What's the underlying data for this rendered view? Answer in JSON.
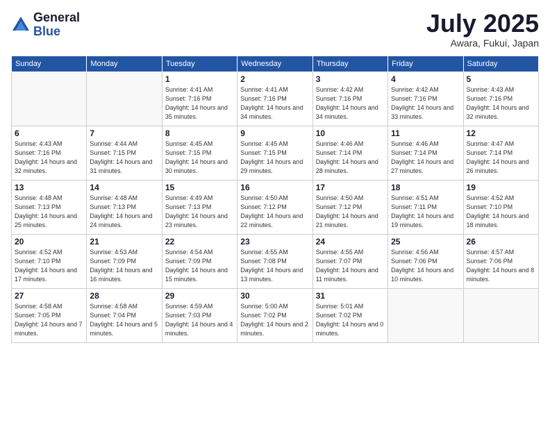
{
  "logo": {
    "general": "General",
    "blue": "Blue"
  },
  "header": {
    "month": "July 2025",
    "location": "Awara, Fukui, Japan"
  },
  "weekdays": [
    "Sunday",
    "Monday",
    "Tuesday",
    "Wednesday",
    "Thursday",
    "Friday",
    "Saturday"
  ],
  "weeks": [
    [
      {
        "day": "",
        "info": ""
      },
      {
        "day": "",
        "info": ""
      },
      {
        "day": "1",
        "sunrise": "Sunrise: 4:41 AM",
        "sunset": "Sunset: 7:16 PM",
        "daylight": "Daylight: 14 hours and 35 minutes."
      },
      {
        "day": "2",
        "sunrise": "Sunrise: 4:41 AM",
        "sunset": "Sunset: 7:16 PM",
        "daylight": "Daylight: 14 hours and 34 minutes."
      },
      {
        "day": "3",
        "sunrise": "Sunrise: 4:42 AM",
        "sunset": "Sunset: 7:16 PM",
        "daylight": "Daylight: 14 hours and 34 minutes."
      },
      {
        "day": "4",
        "sunrise": "Sunrise: 4:42 AM",
        "sunset": "Sunset: 7:16 PM",
        "daylight": "Daylight: 14 hours and 33 minutes."
      },
      {
        "day": "5",
        "sunrise": "Sunrise: 4:43 AM",
        "sunset": "Sunset: 7:16 PM",
        "daylight": "Daylight: 14 hours and 32 minutes."
      }
    ],
    [
      {
        "day": "6",
        "sunrise": "Sunrise: 4:43 AM",
        "sunset": "Sunset: 7:16 PM",
        "daylight": "Daylight: 14 hours and 32 minutes."
      },
      {
        "day": "7",
        "sunrise": "Sunrise: 4:44 AM",
        "sunset": "Sunset: 7:15 PM",
        "daylight": "Daylight: 14 hours and 31 minutes."
      },
      {
        "day": "8",
        "sunrise": "Sunrise: 4:45 AM",
        "sunset": "Sunset: 7:15 PM",
        "daylight": "Daylight: 14 hours and 30 minutes."
      },
      {
        "day": "9",
        "sunrise": "Sunrise: 4:45 AM",
        "sunset": "Sunset: 7:15 PM",
        "daylight": "Daylight: 14 hours and 29 minutes."
      },
      {
        "day": "10",
        "sunrise": "Sunrise: 4:46 AM",
        "sunset": "Sunset: 7:14 PM",
        "daylight": "Daylight: 14 hours and 28 minutes."
      },
      {
        "day": "11",
        "sunrise": "Sunrise: 4:46 AM",
        "sunset": "Sunset: 7:14 PM",
        "daylight": "Daylight: 14 hours and 27 minutes."
      },
      {
        "day": "12",
        "sunrise": "Sunrise: 4:47 AM",
        "sunset": "Sunset: 7:14 PM",
        "daylight": "Daylight: 14 hours and 26 minutes."
      }
    ],
    [
      {
        "day": "13",
        "sunrise": "Sunrise: 4:48 AM",
        "sunset": "Sunset: 7:13 PM",
        "daylight": "Daylight: 14 hours and 25 minutes."
      },
      {
        "day": "14",
        "sunrise": "Sunrise: 4:48 AM",
        "sunset": "Sunset: 7:13 PM",
        "daylight": "Daylight: 14 hours and 24 minutes."
      },
      {
        "day": "15",
        "sunrise": "Sunrise: 4:49 AM",
        "sunset": "Sunset: 7:13 PM",
        "daylight": "Daylight: 14 hours and 23 minutes."
      },
      {
        "day": "16",
        "sunrise": "Sunrise: 4:50 AM",
        "sunset": "Sunset: 7:12 PM",
        "daylight": "Daylight: 14 hours and 22 minutes."
      },
      {
        "day": "17",
        "sunrise": "Sunrise: 4:50 AM",
        "sunset": "Sunset: 7:12 PM",
        "daylight": "Daylight: 14 hours and 21 minutes."
      },
      {
        "day": "18",
        "sunrise": "Sunrise: 4:51 AM",
        "sunset": "Sunset: 7:11 PM",
        "daylight": "Daylight: 14 hours and 19 minutes."
      },
      {
        "day": "19",
        "sunrise": "Sunrise: 4:52 AM",
        "sunset": "Sunset: 7:10 PM",
        "daylight": "Daylight: 14 hours and 18 minutes."
      }
    ],
    [
      {
        "day": "20",
        "sunrise": "Sunrise: 4:52 AM",
        "sunset": "Sunset: 7:10 PM",
        "daylight": "Daylight: 14 hours and 17 minutes."
      },
      {
        "day": "21",
        "sunrise": "Sunrise: 4:53 AM",
        "sunset": "Sunset: 7:09 PM",
        "daylight": "Daylight: 14 hours and 16 minutes."
      },
      {
        "day": "22",
        "sunrise": "Sunrise: 4:54 AM",
        "sunset": "Sunset: 7:09 PM",
        "daylight": "Daylight: 14 hours and 15 minutes."
      },
      {
        "day": "23",
        "sunrise": "Sunrise: 4:55 AM",
        "sunset": "Sunset: 7:08 PM",
        "daylight": "Daylight: 14 hours and 13 minutes."
      },
      {
        "day": "24",
        "sunrise": "Sunrise: 4:55 AM",
        "sunset": "Sunset: 7:07 PM",
        "daylight": "Daylight: 14 hours and 11 minutes."
      },
      {
        "day": "25",
        "sunrise": "Sunrise: 4:56 AM",
        "sunset": "Sunset: 7:06 PM",
        "daylight": "Daylight: 14 hours and 10 minutes."
      },
      {
        "day": "26",
        "sunrise": "Sunrise: 4:57 AM",
        "sunset": "Sunset: 7:06 PM",
        "daylight": "Daylight: 14 hours and 8 minutes."
      }
    ],
    [
      {
        "day": "27",
        "sunrise": "Sunrise: 4:58 AM",
        "sunset": "Sunset: 7:05 PM",
        "daylight": "Daylight: 14 hours and 7 minutes."
      },
      {
        "day": "28",
        "sunrise": "Sunrise: 4:58 AM",
        "sunset": "Sunset: 7:04 PM",
        "daylight": "Daylight: 14 hours and 5 minutes."
      },
      {
        "day": "29",
        "sunrise": "Sunrise: 4:59 AM",
        "sunset": "Sunset: 7:03 PM",
        "daylight": "Daylight: 14 hours and 4 minutes."
      },
      {
        "day": "30",
        "sunrise": "Sunrise: 5:00 AM",
        "sunset": "Sunset: 7:02 PM",
        "daylight": "Daylight: 14 hours and 2 minutes."
      },
      {
        "day": "31",
        "sunrise": "Sunrise: 5:01 AM",
        "sunset": "Sunset: 7:02 PM",
        "daylight": "Daylight: 14 hours and 0 minutes."
      },
      {
        "day": "",
        "info": ""
      },
      {
        "day": "",
        "info": ""
      }
    ]
  ]
}
